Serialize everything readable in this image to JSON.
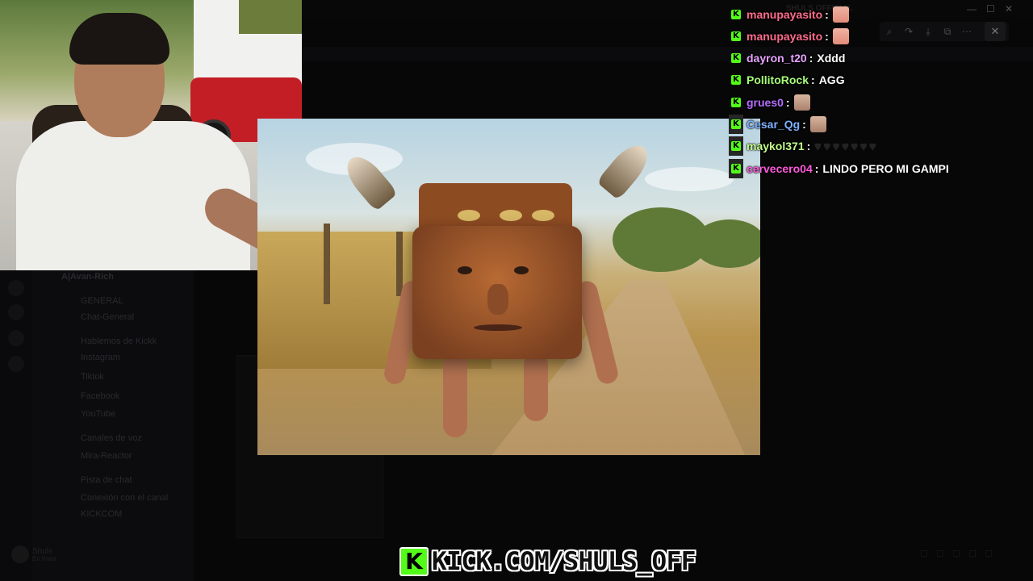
{
  "background_app": {
    "window_title": "SHULS OFFICIAL",
    "server_name": "A|Avan-Rich",
    "channels": [
      "GENERAL",
      "Chat-General",
      "Hablemos de Kickk",
      "Instagram",
      "Tiktok",
      "Facebook",
      "YouTube",
      "Canales de voz",
      "Mira-Reactor",
      "Pista de chat",
      "Conexión con el canal",
      "KICKCOM"
    ],
    "user_name": "Shuls",
    "user_status": "En línea"
  },
  "chat": {
    "messages": [
      {
        "user": "manupayasito",
        "color": "#ff6b8b",
        "text": "",
        "emote": "hand"
      },
      {
        "user": "manupayasito",
        "color": "#ff6b8b",
        "text": "",
        "emote": "hand"
      },
      {
        "user": "dayron_t20",
        "color": "#e7a4ff",
        "text": "Xddd",
        "emote": ""
      },
      {
        "user": "PollitoRock",
        "color": "#a6ff78",
        "text": "AGG",
        "emote": ""
      },
      {
        "user": "grues0",
        "color": "#b46dff",
        "text": "",
        "emote": "face"
      },
      {
        "user": "Cesar_Qg",
        "color": "#7fb2ff",
        "text": "",
        "emote": "face"
      },
      {
        "user": "maykol371",
        "color": "#c3ff8b",
        "text": "",
        "emote": "hearts"
      },
      {
        "user": "cervecero04",
        "color": "#ff5adc",
        "text": "LINDO PERO MI GAMPI",
        "emote": ""
      }
    ],
    "separator": ":",
    "badge_letter": "K",
    "badge_color": "#53fc18"
  },
  "banner": {
    "letter": "K",
    "text": "KICK.COM/SHULS_OFF"
  },
  "viewer_toolbar": {
    "icons": [
      "zoom-icon",
      "rotate-icon",
      "download-icon",
      "open-external-icon",
      "more-icon"
    ],
    "close": "✕"
  }
}
